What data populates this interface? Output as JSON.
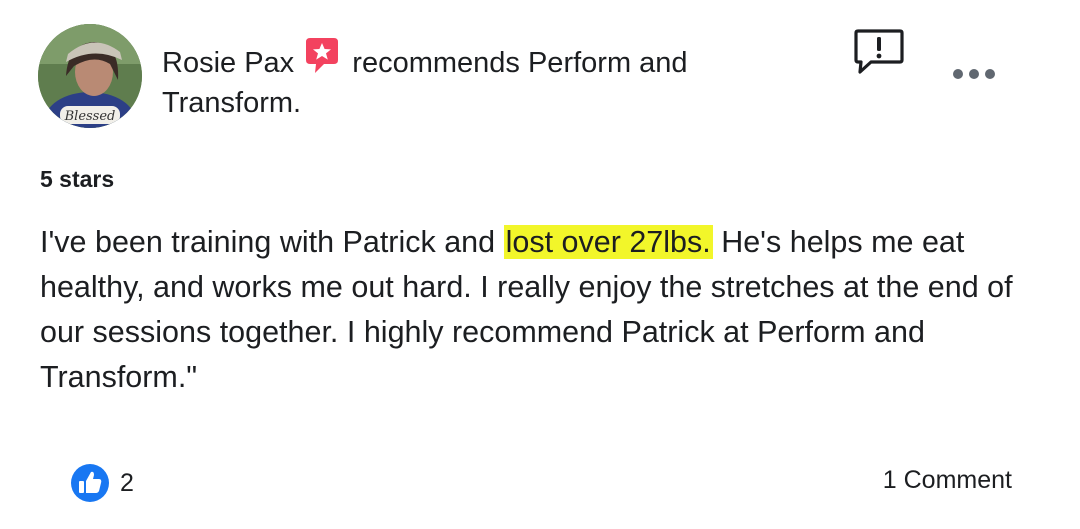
{
  "post": {
    "author": "Rosie Pax",
    "action_text": " recommends Perform and Transform.",
    "avatar_caption": "Blessed",
    "rating_text": "5 stars",
    "review_before": "I've been training with Patrick and ",
    "review_highlight": "lost over 27lbs.",
    "review_after": " He's helps me eat healthy, and works me out hard. I really enjoy the stretches at the end of our sessions together. I highly recommend Patrick at Perform and Transform.\"",
    "like_count": "2",
    "comments_label": "1 Comment"
  },
  "colors": {
    "recommend_badge": "#f3425f",
    "like_blue": "#1877f2",
    "highlight": "#f2f62a",
    "text": "#1c1e21"
  },
  "icons": {
    "recommend": "recommend-badge-icon",
    "report": "report-icon",
    "more": "more-options-icon",
    "like": "like-icon"
  }
}
